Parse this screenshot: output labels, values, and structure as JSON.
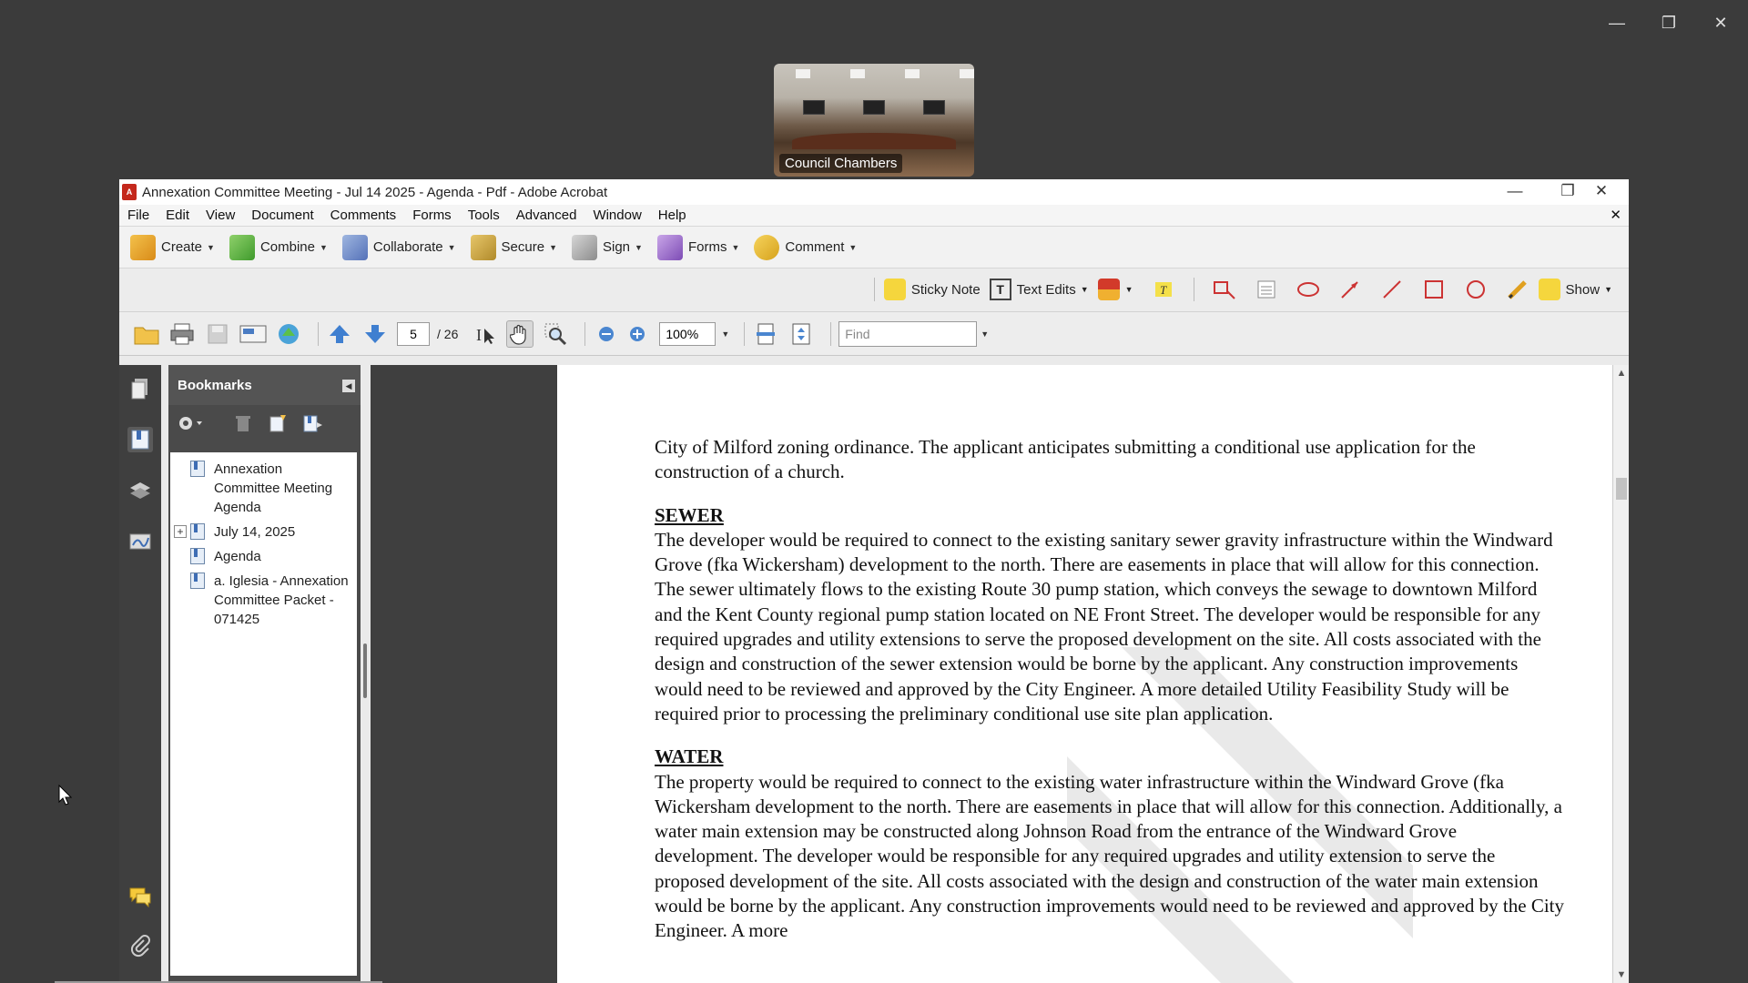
{
  "desktop": {
    "controls": {
      "minimize": "—",
      "restore": "❐",
      "close": "✕"
    }
  },
  "video": {
    "label": "Council Chambers"
  },
  "window": {
    "title": "Annexation Committee Meeting - Jul 14 2025 - Agenda - Pdf - Adobe Acrobat",
    "controls": {
      "minimize": "—",
      "restore": "❐",
      "close": "✕"
    }
  },
  "menu": {
    "items": [
      "File",
      "Edit",
      "View",
      "Document",
      "Comments",
      "Forms",
      "Tools",
      "Advanced",
      "Window",
      "Help"
    ],
    "close_doc": "✕"
  },
  "tasks_toolbar": {
    "create": "Create",
    "combine": "Combine",
    "collaborate": "Collaborate",
    "secure": "Secure",
    "sign": "Sign",
    "forms": "Forms",
    "comment": "Comment"
  },
  "comment_toolbar": {
    "sticky_note": "Sticky Note",
    "text_edits": "Text Edits",
    "show": "Show"
  },
  "nav_toolbar": {
    "current_page": "5",
    "total_pages": "/ 26",
    "zoom": "100%",
    "find_placeholder": "Find"
  },
  "bookmarks": {
    "title": "Bookmarks",
    "items": [
      {
        "label": "Annexation Committee Meeting Agenda",
        "expandable": false
      },
      {
        "label": "July 14, 2025",
        "expandable": true
      },
      {
        "label": "Agenda",
        "expandable": false
      },
      {
        "label": "a. Iglesia - Annexation Committee Packet - 071425",
        "expandable": false
      }
    ]
  },
  "document": {
    "intro": "City of Milford zoning ordinance.  The applicant anticipates submitting a conditional use application for the construction of a church.",
    "sewer_heading": "SEWER",
    "sewer_body": "The developer would be required to connect to the existing sanitary sewer gravity infrastructure within the Windward Grove (fka Wickersham) development to the north.  There are easements in place that will allow for this connection.  The sewer ultimately flows to the existing Route 30 pump station, which conveys the sewage to downtown Milford and the Kent County regional pump station located on NE Front Street.  The developer would be responsible for any required upgrades and utility extensions to serve the proposed development on the site.  All costs associated with the design and construction of the sewer extension would be borne by the applicant.  Any construction improvements would need to be reviewed and approved by the City Engineer.  A more detailed Utility Feasibility Study will be required prior to processing the preliminary conditional use site plan application.",
    "water_heading": "WATER",
    "water_body": "The property would be required to connect to the existing water infrastructure within the Windward Grove (fka Wickersham development to the north.  There are easements in place that will allow for this connection.  Additionally, a water main extension may be constructed along Johnson Road from the entrance of the Windward Grove development.  The developer would be responsible for any required upgrades and utility extension to serve the proposed development of the site.   All costs associated with the design and construction of the water main extension would be borne by the applicant.  Any construction improvements would need to be reviewed and approved by the City Engineer.  A more"
  }
}
